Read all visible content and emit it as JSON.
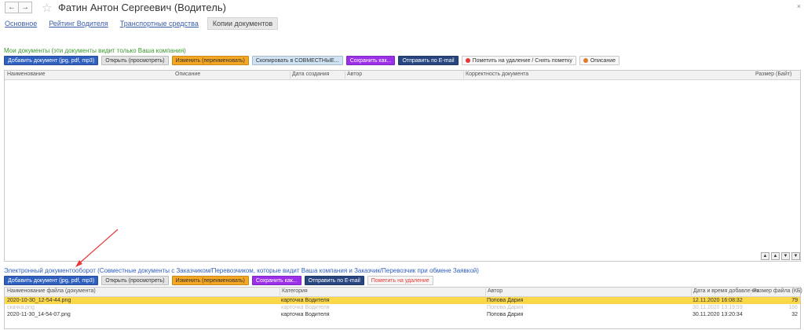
{
  "header": {
    "back_icon": "←",
    "forward_icon": "→",
    "star_icon": "☆",
    "title": "Фатин Антон Сергеевич (Водитель)",
    "close_icon": "×"
  },
  "tabs": [
    {
      "label": "Основное"
    },
    {
      "label": "Рейтинг Водителя"
    },
    {
      "label": "Транспортные средства"
    },
    {
      "label": "Копии документов"
    }
  ],
  "my_docs": {
    "caption": "Мои документы (эти документы видит только Ваша компания)",
    "caption_color": "#3c9a2f",
    "toolbar": {
      "add": "Добавить документ (jpg, pdf, mp3)",
      "open": "Открыть (просмотреть)",
      "rename": "Изменить (переименовать)",
      "copy_shared": "Скопировать в СОВМЕСТНЫЕ...",
      "save_as": "Сохранить как...",
      "send_email": "Отправить по E-mail",
      "mark_delete": "Пометить на удаление / Снять пометку",
      "description": "Описание"
    },
    "columns": {
      "name": "Наименование",
      "description": "Описание",
      "created": "Дата создания",
      "author": "Автор",
      "correctness": "Корректность документа",
      "size": "Размер (Байт)"
    },
    "scroll": {
      "top": "▲",
      "up": "▲",
      "down": "▼",
      "bottom": "▼"
    }
  },
  "edo": {
    "caption": "Электронный документооборот (Совместные документы с Заказчиком/Перевозчиком, которые видит Ваша компания и Заказчик/Перевозчик при обмене Заявкой)",
    "caption_color": "#2f5fbf",
    "toolbar": {
      "add": "Добавить документ (jpg, pdf, mp3)",
      "open": "Открыть (просмотреть)",
      "rename": "Изменить (переименовать)",
      "save_as": "Сохранить как...",
      "send_email": "Отправить по E-mail",
      "mark_delete": "Пометить на удаление"
    },
    "columns": {
      "file_name": "Наименование файла (документа)",
      "category": "Категория",
      "author": "Автор",
      "datetime": "Дата и время добавления",
      "size": "Размер файла (КБ)"
    },
    "rows": [
      {
        "name": "2020-10-30_12-54-44.png",
        "category": "карточка Водителя",
        "author": "Попова Дария",
        "date": "12.11.2020 16:08:32",
        "size": "79",
        "state": "selected"
      },
      {
        "name": "скачка.png",
        "category": "карточка Водителя",
        "author": "Попова Дария",
        "date": "30.11.2020 13:19:59",
        "size": "166",
        "state": "greyed"
      },
      {
        "name": "2020-11-30_14-54-07.png",
        "category": "карточка Водителя",
        "author": "Попова Дария",
        "date": "30.11.2020 13:20:34",
        "size": "32",
        "state": "normal"
      }
    ]
  },
  "annotation": {
    "arrow_color": "#e53935",
    "arrow_icon": "red-arrow-icon"
  }
}
